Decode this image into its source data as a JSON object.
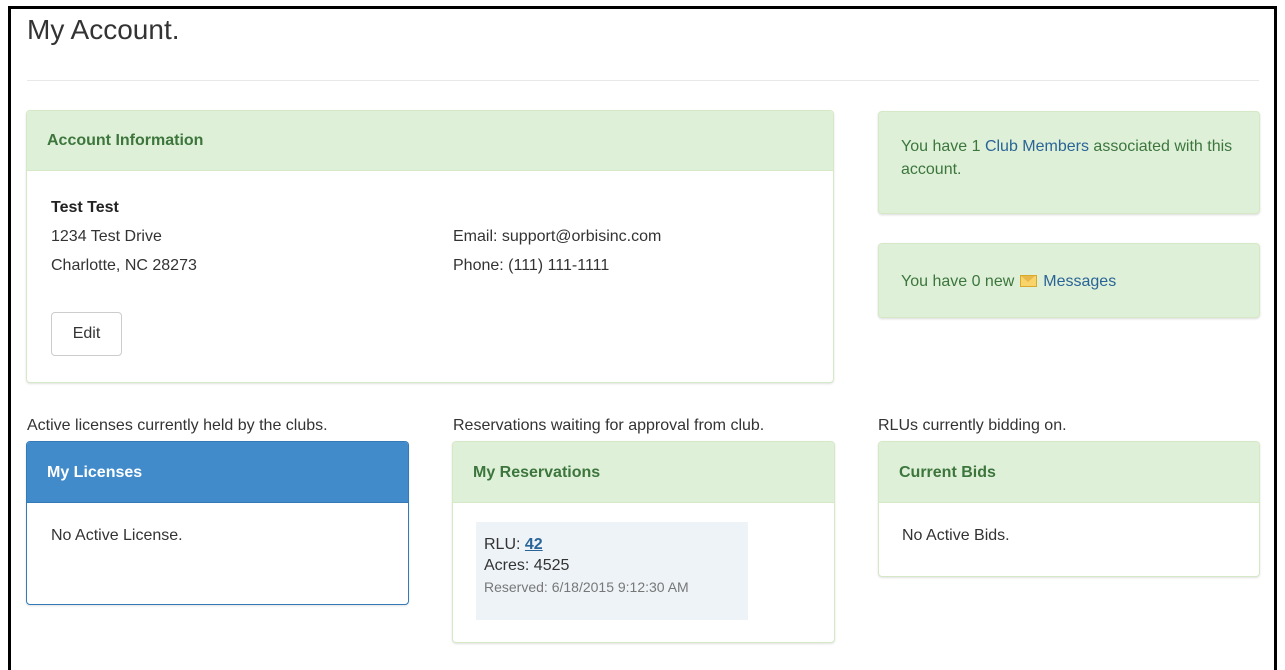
{
  "page": {
    "title": "My Account."
  },
  "account": {
    "heading": "Account Information",
    "name": "Test Test",
    "address_line1": "1234 Test Drive",
    "address_line2": "Charlotte, NC 28273",
    "email_text": "Email: support@orbisinc.com",
    "phone_text": "Phone: (111) 111-1111",
    "edit_label": "Edit"
  },
  "club_alert": {
    "prefix": "You have 1 ",
    "link": "Club Members",
    "suffix": "  associated with this account."
  },
  "messages_alert": {
    "prefix": "You have 0 new",
    "icon": "envelope-icon",
    "link": "Messages"
  },
  "licenses": {
    "caption": "Active licenses currently held by the clubs.",
    "heading": "My Licenses",
    "empty": "No Active License."
  },
  "reservations": {
    "caption": "Reservations waiting for approval from club.",
    "heading": "My Reservations",
    "items": [
      {
        "rlu_label": "RLU: ",
        "rlu_value": "42",
        "acres": "Acres: 4525",
        "reserved": "Reserved: 6/18/2015 9:12:30 AM"
      }
    ]
  },
  "bids": {
    "caption": "RLUs currently bidding on.",
    "heading": "Current Bids",
    "empty": "No Active Bids."
  },
  "colors": {
    "panel_heading_bg": "#dff0d8",
    "panel_heading_text": "#3c763d",
    "primary_heading_bg": "#428bca",
    "link": "#2a6496"
  }
}
